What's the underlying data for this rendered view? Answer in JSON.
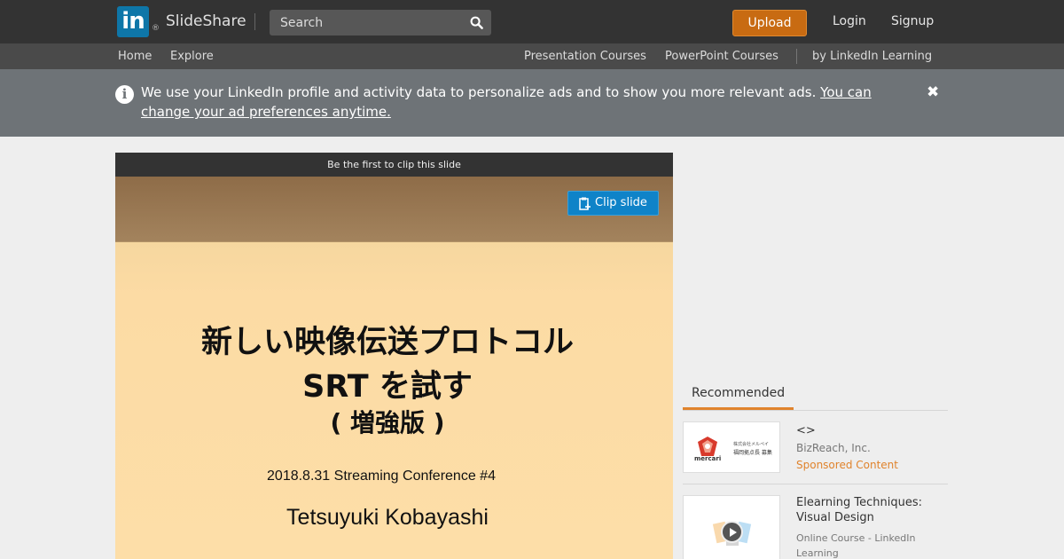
{
  "header": {
    "logo_text": "in",
    "logo_mark": "®",
    "brand": "SlideShare",
    "search_placeholder": "Search",
    "upload_label": "Upload",
    "login_label": "Login",
    "signup_label": "Signup"
  },
  "subnav": {
    "home": "Home",
    "explore": "Explore",
    "presentation_courses": "Presentation Courses",
    "powerpoint_courses": "PowerPoint Courses",
    "linkedin_learning": "by LinkedIn Learning"
  },
  "notice": {
    "text": "We use your LinkedIn profile and activity data to personalize ads and to show you more relevant ads.",
    "link": "You can change your ad preferences anytime.",
    "close_glyph": "✖"
  },
  "viewer": {
    "clip_bar_text": "Be the first to clip this slide",
    "clip_button_label": "Clip slide"
  },
  "slide": {
    "title_line1": "新しい映像伝送プロトコル",
    "title_line2": "SRT を試す",
    "title_line3": "( 増強版 )",
    "event": "2018.8.31 Streaming Conference #4",
    "author": "Tetsuyuki Kobayashi"
  },
  "recommended": {
    "tab_label": "Recommended",
    "items": [
      {
        "title": "<>",
        "subtitle": "BizReach, Inc.",
        "sponsored": "Sponsored Content",
        "thumb_brand": "mercari",
        "thumb_caption_1": "株式会社メルペイ",
        "thumb_caption_2": "福岡拠点長 募集"
      },
      {
        "title": "Elearning Techniques: Visual Design",
        "subtitle": "Online Course - LinkedIn Learning"
      }
    ]
  },
  "colors": {
    "accent_orange": "#c86b12",
    "linkedin_blue": "#0e76a8",
    "clip_blue": "#0f83c8"
  }
}
